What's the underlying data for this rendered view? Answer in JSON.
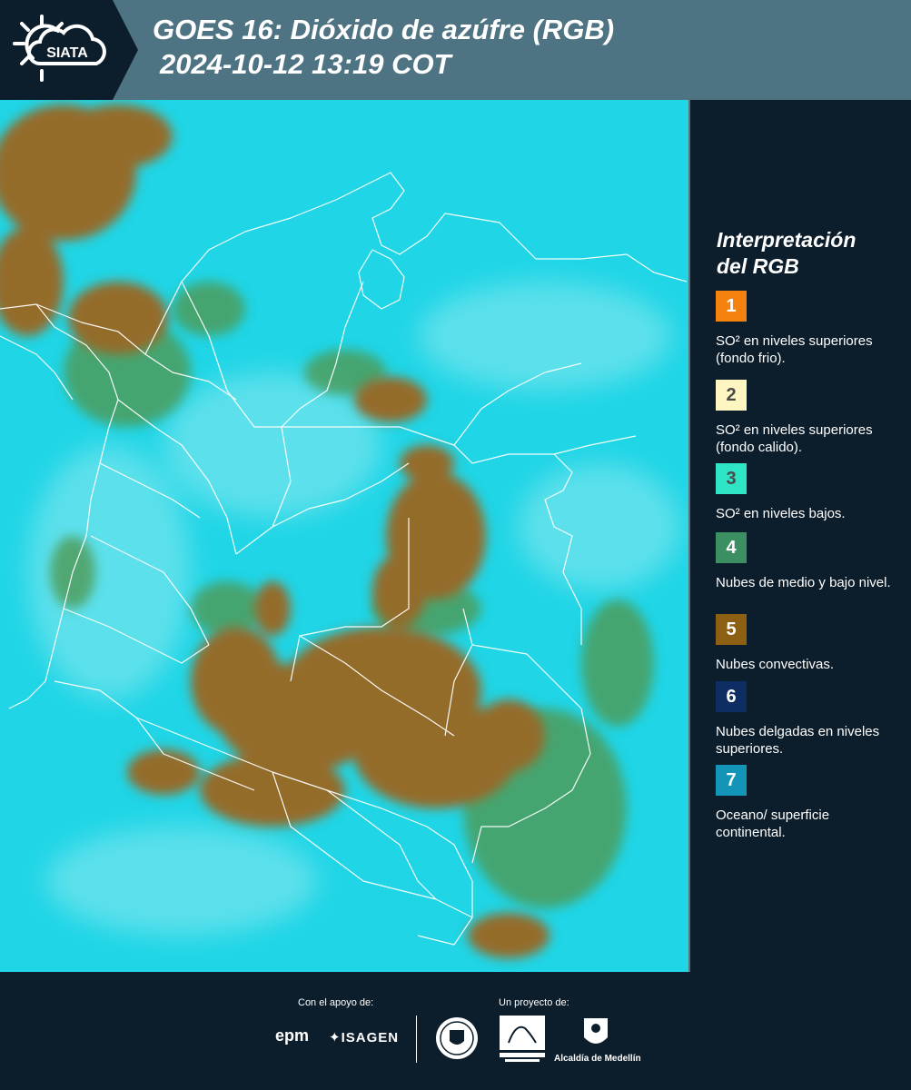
{
  "header": {
    "logo_text": "SIATA",
    "title_line1": "GOES 16: Dióxido de azúfre (RGB)",
    "title_line2": "2024-10-12 13:19 COT"
  },
  "legend": {
    "title_line1": "Interpretación",
    "title_line2": "del RGB",
    "items": [
      {
        "number": "1",
        "color": "#f5820f",
        "text": "SO² en niveles superiores (fondo frio)."
      },
      {
        "number": "2",
        "color": "#fdf6c0",
        "text": "SO² en niveles superiores (fondo calido)."
      },
      {
        "number": "3",
        "color": "#2ee4c4",
        "text": "SO² en niveles bajos."
      },
      {
        "number": "4",
        "color": "#3b8f62",
        "text": "Nubes de medio y bajo nivel."
      },
      {
        "number": "5",
        "color": "#8c5f12",
        "text": "Nubes convectivas."
      },
      {
        "number": "6",
        "color": "#0e2d62",
        "text": "Nubes delgadas en niveles superiores."
      },
      {
        "number": "7",
        "color": "#1395b8",
        "text": "Oceano/ superficie continental."
      }
    ]
  },
  "map": {
    "background_color": "#1ed6e6",
    "cloud_color": "#946c2c",
    "border_color": "#ffffff"
  },
  "footer": {
    "support_label": "Con el apoyo de:",
    "project_label": "Un proyecto de:",
    "sponsor_epm": "epm",
    "sponsor_isagen": "ISAGEN",
    "alcaldia_label": "Alcaldía de Medellín"
  }
}
